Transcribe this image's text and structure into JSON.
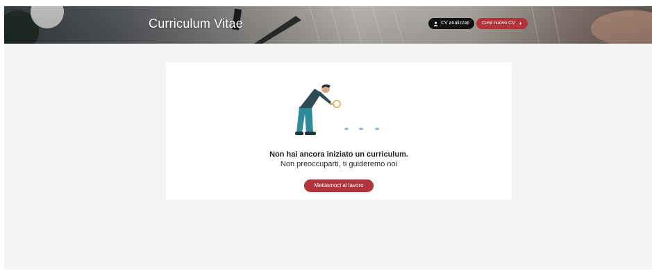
{
  "header": {
    "title": "Curriculum Vitae",
    "analyzed_button": {
      "label": "CV analizzati",
      "icon": "user-icon"
    },
    "new_button": {
      "label": "Crea nuovo CV",
      "icon": "plus-icon",
      "icon_glyph": "+"
    }
  },
  "empty_state": {
    "illustration": "person-with-magnifying-glass-illustration",
    "title": "Non hai ancora iniziato un curriculum.",
    "subtitle": "Non preoccuparti, ti guideremo noi",
    "cta_label": "Mettiamoci al lavoro"
  },
  "colors": {
    "accent": "#b1343d",
    "dark_button": "#111111",
    "page_background": "#f3f4f4",
    "illustration_teal": "#2e8a9b",
    "illustration_dots": "#7fb6dd"
  }
}
